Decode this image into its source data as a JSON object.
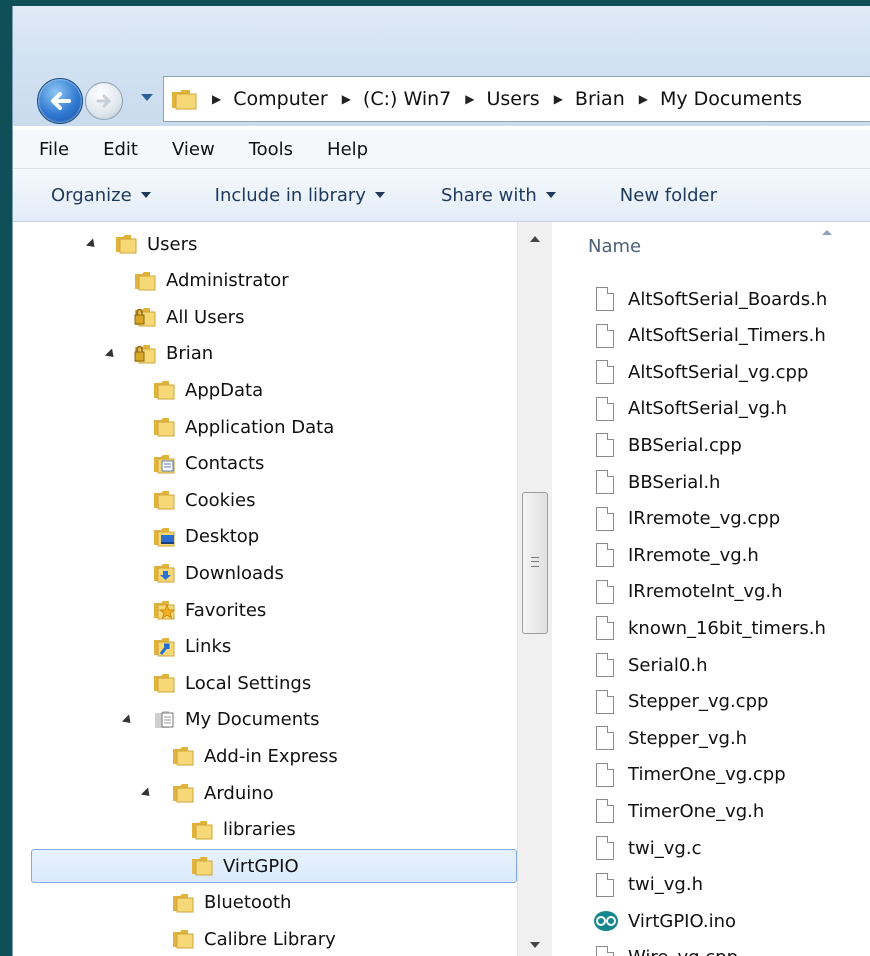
{
  "breadcrumb": [
    "Computer",
    "(C:) Win7",
    "Users",
    "Brian",
    "My Documents"
  ],
  "menu": [
    "File",
    "Edit",
    "View",
    "Tools",
    "Help"
  ],
  "toolbar": {
    "organize": "Organize",
    "include": "Include in library",
    "share": "Share with",
    "new_folder": "New folder"
  },
  "tree": [
    {
      "label": "Users",
      "expander": "open",
      "icon": "folder"
    },
    {
      "label": "Administrator",
      "expander": "none",
      "icon": "folder"
    },
    {
      "label": "All Users",
      "expander": "closed",
      "icon": "lock-folder"
    },
    {
      "label": "Brian",
      "expander": "open",
      "icon": "lock-folder"
    },
    {
      "label": "AppData",
      "expander": "closed",
      "icon": "folder"
    },
    {
      "label": "Application Data",
      "expander": "closed",
      "icon": "folder"
    },
    {
      "label": "Contacts",
      "expander": "none",
      "icon": "contacts-folder"
    },
    {
      "label": "Cookies",
      "expander": "closed",
      "icon": "folder"
    },
    {
      "label": "Desktop",
      "expander": "closed",
      "icon": "desktop-folder"
    },
    {
      "label": "Downloads",
      "expander": "none",
      "icon": "downloads-folder"
    },
    {
      "label": "Favorites",
      "expander": "closed",
      "icon": "favorites-folder"
    },
    {
      "label": "Links",
      "expander": "none",
      "icon": "links-folder"
    },
    {
      "label": "Local Settings",
      "expander": "closed",
      "icon": "folder"
    },
    {
      "label": "My Documents",
      "expander": "open",
      "icon": "documents-folder"
    },
    {
      "label": "Add-in Express",
      "expander": "none",
      "icon": "folder"
    },
    {
      "label": "Arduino",
      "expander": "open",
      "icon": "folder"
    },
    {
      "label": "libraries",
      "expander": "none",
      "icon": "folder"
    },
    {
      "label": "VirtGPIO",
      "expander": "none",
      "icon": "folder",
      "selected": true
    },
    {
      "label": "Bluetooth",
      "expander": "closed",
      "icon": "folder"
    },
    {
      "label": "Calibre Library",
      "expander": "closed",
      "icon": "folder"
    }
  ],
  "files_header": "Name",
  "files": [
    {
      "name": "AltSoftSerial_Boards.h",
      "icon": "document"
    },
    {
      "name": "AltSoftSerial_Timers.h",
      "icon": "document"
    },
    {
      "name": "AltSoftSerial_vg.cpp",
      "icon": "document"
    },
    {
      "name": "AltSoftSerial_vg.h",
      "icon": "document"
    },
    {
      "name": "BBSerial.cpp",
      "icon": "document"
    },
    {
      "name": "BBSerial.h",
      "icon": "document"
    },
    {
      "name": "IRremote_vg.cpp",
      "icon": "document"
    },
    {
      "name": "IRremote_vg.h",
      "icon": "document"
    },
    {
      "name": "IRremoteInt_vg.h",
      "icon": "document"
    },
    {
      "name": "known_16bit_timers.h",
      "icon": "document"
    },
    {
      "name": "Serial0.h",
      "icon": "document"
    },
    {
      "name": "Stepper_vg.cpp",
      "icon": "document"
    },
    {
      "name": "Stepper_vg.h",
      "icon": "document"
    },
    {
      "name": "TimerOne_vg.cpp",
      "icon": "document"
    },
    {
      "name": "TimerOne_vg.h",
      "icon": "document"
    },
    {
      "name": "twi_vg.c",
      "icon": "document"
    },
    {
      "name": "twi_vg.h",
      "icon": "document"
    },
    {
      "name": "VirtGPIO.ino",
      "icon": "arduino"
    },
    {
      "name": "Wire_vg.cpp",
      "icon": "document"
    }
  ]
}
